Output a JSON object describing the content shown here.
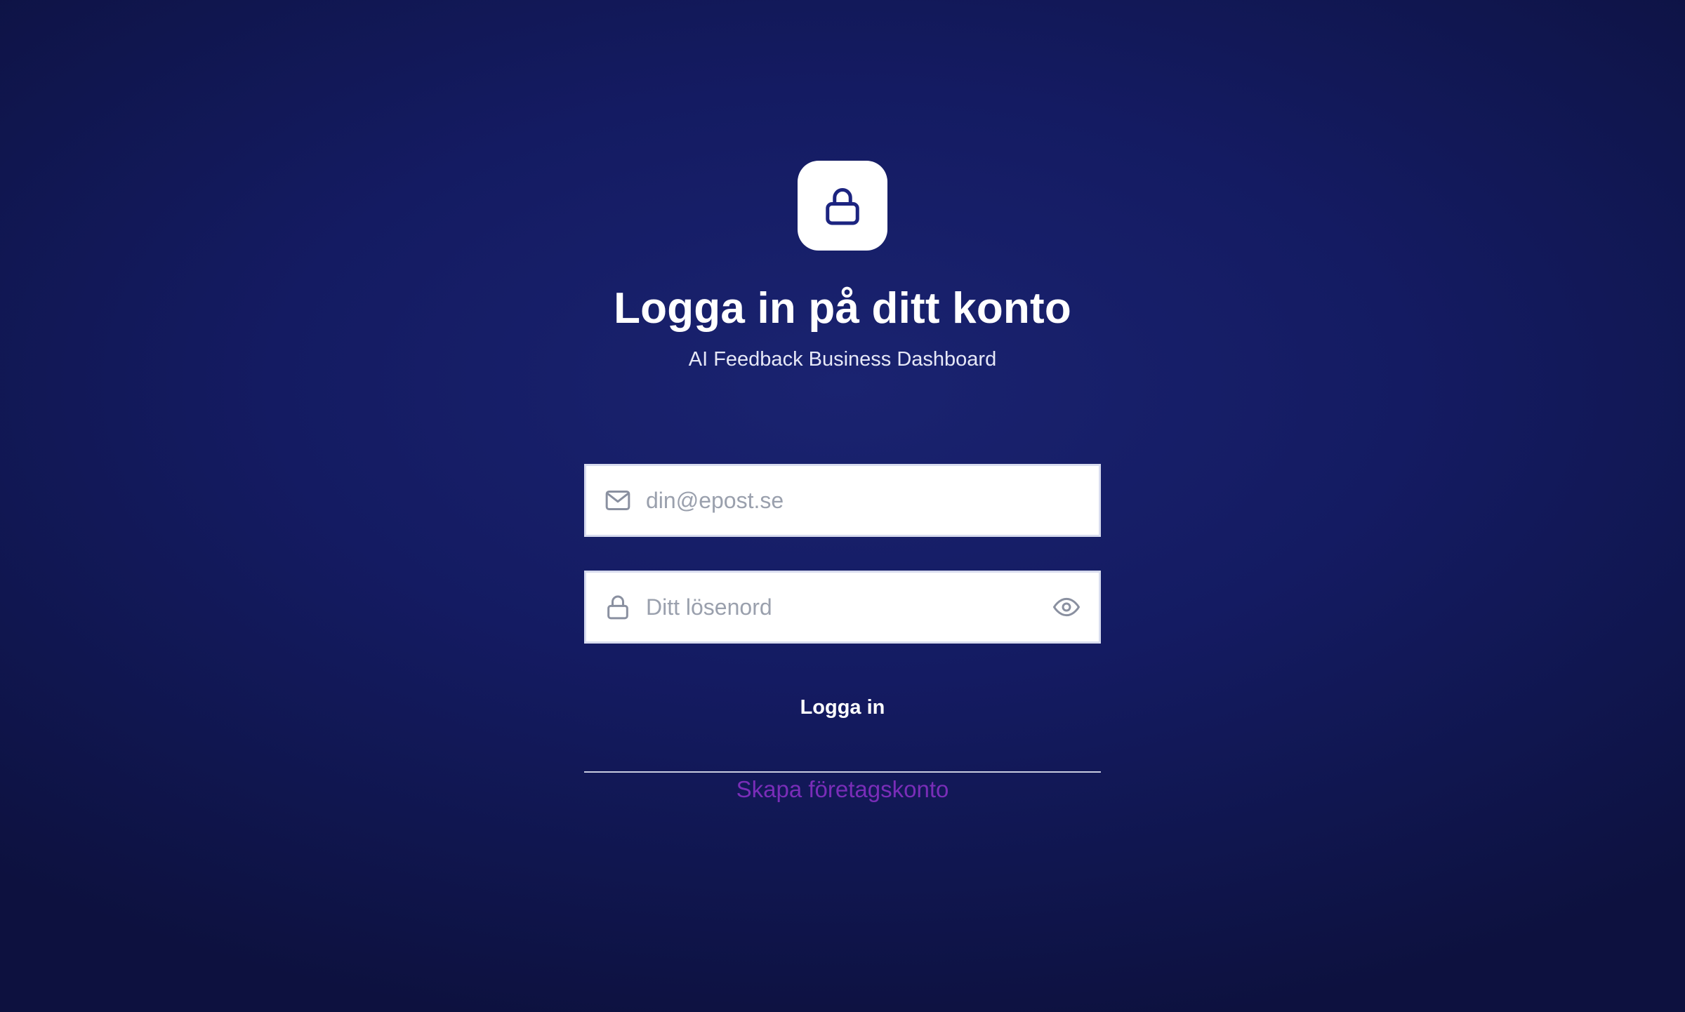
{
  "header": {
    "logo_icon": "lock-icon",
    "title": "Logga in på ditt konto",
    "subtitle": "AI Feedback Business Dashboard"
  },
  "form": {
    "email": {
      "icon": "mail-icon",
      "value": "",
      "placeholder": "din@epost.se"
    },
    "password": {
      "icon": "lock-icon",
      "value": "",
      "placeholder": "Ditt lösenord",
      "toggle_icon": "eye-icon"
    },
    "submit_label": "Logga in",
    "create_account_label": "Skapa företagskonto"
  },
  "colors": {
    "background": "#141b62",
    "logo_icon": "#1c2480",
    "link": "#7a2db8",
    "field_icon": "#8a90a0"
  }
}
